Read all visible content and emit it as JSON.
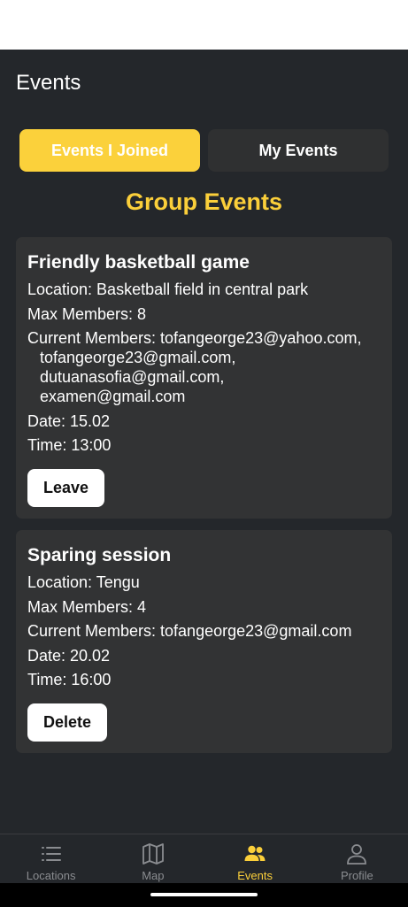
{
  "header": {
    "title": "Events"
  },
  "tabs": [
    {
      "label": "Events I Joined",
      "active": true
    },
    {
      "label": "My Events",
      "active": false
    }
  ],
  "section_title": "Group Events",
  "events": [
    {
      "title": "Friendly basketball game",
      "location": "Location: Basketball field in central park",
      "max_members": "Max Members: 8",
      "current_members_label": "Current Members: tofangeorge23@yahoo.com,",
      "members_extra": [
        "tofangeorge23@gmail.com,",
        "dutuanasofia@gmail.com,",
        "examen@gmail.com"
      ],
      "date": "Date: 15.02",
      "time": "Time: 13:00",
      "action_label": "Leave"
    },
    {
      "title": "Sparing session",
      "location": "Location: Tengu",
      "max_members": "Max Members: 4",
      "current_members_label": "Current Members: tofangeorge23@gmail.com",
      "date": "Date: 20.02",
      "time": "Time: 16:00",
      "action_label": "Delete"
    }
  ],
  "bottom_nav": [
    {
      "label": "Locations",
      "icon": "list-icon",
      "active": false
    },
    {
      "label": "Map",
      "icon": "map-icon",
      "active": false
    },
    {
      "label": "Events",
      "icon": "people-icon",
      "active": true
    },
    {
      "label": "Profile",
      "icon": "person-icon",
      "active": false
    }
  ],
  "colors": {
    "accent": "#fbcf3a",
    "background": "#24272b",
    "card": "#323334"
  }
}
